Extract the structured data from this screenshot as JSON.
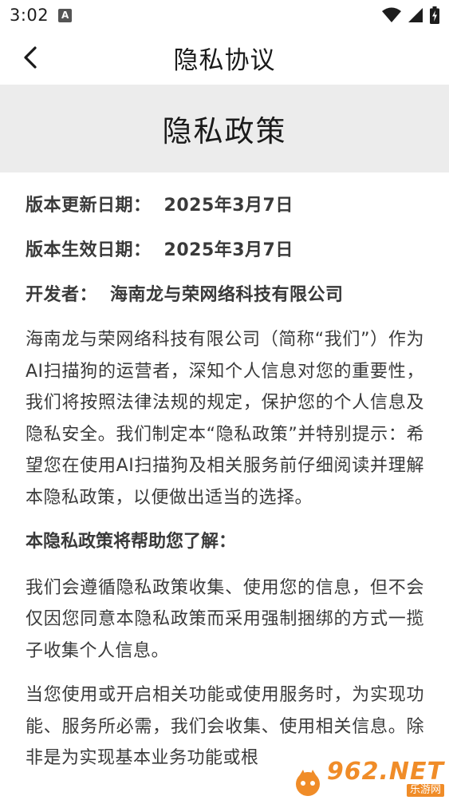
{
  "status_bar": {
    "time": "3:02",
    "notification_glyph": "A"
  },
  "nav": {
    "title": "隐私协议"
  },
  "hero": {
    "title": "隐私政策"
  },
  "meta": [
    {
      "label": "版本更新日期：",
      "value": "2025年3月7日"
    },
    {
      "label": "版本生效日期：",
      "value": "2025年3月7日"
    },
    {
      "label": "开发者：",
      "value": "海南龙与荣网络科技有限公司"
    }
  ],
  "body": {
    "intro": "海南龙与荣网络科技有限公司（简称“我们”）作为AI扫描狗的运营者，深知个人信息对您的重要性，我们将按照法律法规的规定，保护您的个人信息及隐私安全。我们制定本“隐私政策”并特别提示：希望您在使用AI扫描狗及相关服务前仔细阅读并理解本隐私政策，以便做出适当的选择。",
    "subhead": "本隐私政策将帮助您了解：",
    "p1": "我们会遵循隐私政策收集、使用您的信息，但不会仅因您同意本隐私政策而采用强制捆绑的方式一揽子收集个人信息。",
    "p2": "当您使用或开启相关功能或使用服务时，为实现功能、服务所必需，我们会收集、使用相关信息。除非是为实现基本业务功能或根"
  },
  "watermark": {
    "brand": "962.NET",
    "sub": "乐游网"
  },
  "colors": {
    "hero_bg": "#ececec",
    "text": "#3a3a3a",
    "watermark": "#f08c28"
  },
  "icons": {
    "back": "chevron-left-icon",
    "wifi": "wifi-icon",
    "signal": "signal-icon",
    "battery": "battery-icon"
  }
}
